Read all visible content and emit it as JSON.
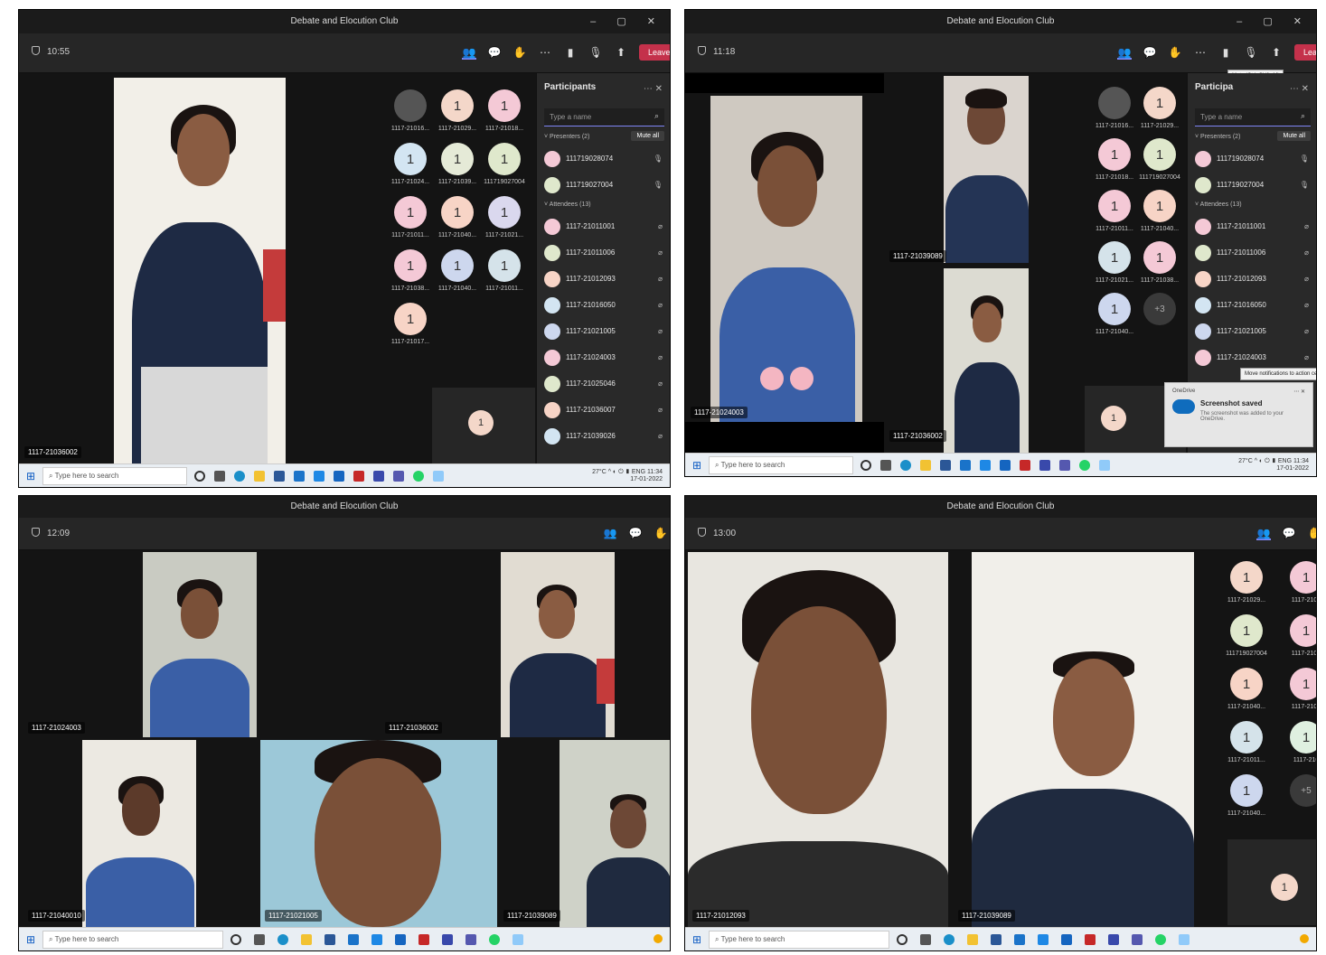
{
  "panels": {
    "p1": {
      "title": "Debate and Elocution Club",
      "time": "10:55",
      "leave_label": "Leave",
      "main_video_name": "1117-21036002",
      "self_view_avatar": "1",
      "avatars": [
        {
          "initial": "",
          "name": "1117-21016...",
          "color": "#555555"
        },
        {
          "initial": "1",
          "name": "1117-21029...",
          "color": "#f4d7c9"
        },
        {
          "initial": "1",
          "name": "1117-21018...",
          "color": "#f4c9d6"
        },
        {
          "initial": "1",
          "name": "1117-21024...",
          "color": "#d3e5f2"
        },
        {
          "initial": "1",
          "name": "1117-21039...",
          "color": "#e5ead7"
        },
        {
          "initial": "1",
          "name": "111719027004",
          "color": "#dfe8cc"
        },
        {
          "initial": "1",
          "name": "1117-21011...",
          "color": "#f4c9d6"
        },
        {
          "initial": "1",
          "name": "1117-21040...",
          "color": "#f7d4c6"
        },
        {
          "initial": "1",
          "name": "1117-21021...",
          "color": "#dad8ee"
        },
        {
          "initial": "1",
          "name": "1117-21038...",
          "color": "#f4c9d6"
        },
        {
          "initial": "1",
          "name": "1117-21040...",
          "color": "#cdd7ee"
        },
        {
          "initial": "1",
          "name": "1117-21011...",
          "color": "#d5e3ea"
        },
        {
          "initial": "1",
          "name": "1117-21017...",
          "color": "#f7d4c6"
        }
      ],
      "participants_title": "Participants",
      "search_placeholder": "Type a name",
      "presenters_label": "Presenters (2)",
      "mute_all_label": "Mute all",
      "attendees_label": "Attendees (13)",
      "presenters": [
        "111719028074",
        "111719027004"
      ],
      "attendees": [
        "1117-21011001",
        "1117-21011006",
        "1117-21012093",
        "1117-21016050",
        "1117-21021005",
        "1117-21024003",
        "1117-21025046",
        "1117-21036007",
        "1117-21039026"
      ]
    },
    "p2": {
      "title": "Debate and Elocution Club",
      "time": "11:18",
      "leave_label": "Leave",
      "mute_tooltip": "Mute (Ctrl+Shift+M)",
      "videos": [
        "1117-21024003",
        "1117-21039089",
        "1117-21036002"
      ],
      "avatars": [
        {
          "initial": "",
          "name": "1117-21016...",
          "color": "#555555"
        },
        {
          "initial": "1",
          "name": "1117-21029...",
          "color": "#f4d7c9"
        },
        {
          "initial": "1",
          "name": "1117-21018...",
          "color": "#f4c9d6"
        },
        {
          "initial": "1",
          "name": "111719027004",
          "color": "#dfe8cc"
        },
        {
          "initial": "1",
          "name": "1117-21011...",
          "color": "#f4c9d6"
        },
        {
          "initial": "1",
          "name": "1117-21040...",
          "color": "#f7d4c6"
        },
        {
          "initial": "1",
          "name": "1117-21021...",
          "color": "#d5e3ea"
        },
        {
          "initial": "1",
          "name": "1117-21038...",
          "color": "#f4c9d6"
        },
        {
          "initial": "1",
          "name": "1117-21040...",
          "color": "#cdd7ee"
        },
        {
          "initial": "+3",
          "name": "",
          "color": "#3a3a3a"
        }
      ],
      "self_view_avatar": "1",
      "participants_title": "Participa",
      "search_placeholder": "Type a name",
      "presenters_label": "Presenters (2)",
      "mute_all_label": "Mute all",
      "attendees_label": "Attendees (13)",
      "presenters": [
        "111719028074",
        "111719027004"
      ],
      "attendees": [
        "1117-21011001",
        "1117-21011006",
        "1117-21012093",
        "1117-21016050",
        "1117-21021005",
        "1117-21024003"
      ],
      "notification_tooltip": "Move notifications to action center",
      "toast": {
        "app": "OneDrive",
        "title": "Screenshot saved",
        "body": "The screenshot was added to your OneDrive."
      }
    },
    "p3": {
      "title": "Debate and Elocution Club",
      "time": "12:09",
      "videos": [
        "1117-21024003",
        "1117-21036002",
        "1117-21040010",
        "1117-21021005",
        "1117-21039089"
      ]
    },
    "p4": {
      "title": "Debate and Elocution Club",
      "time": "13:00",
      "videos": [
        "1117-21012093",
        "1117-21039089"
      ],
      "avatars": [
        {
          "initial": "1",
          "name": "1117-21029...",
          "color": "#f4d7c9"
        },
        {
          "initial": "1",
          "name": "1117-2104",
          "color": "#f4c9d6"
        },
        {
          "initial": "1",
          "name": "111719027004",
          "color": "#dfe8cc"
        },
        {
          "initial": "1",
          "name": "1117-2101",
          "color": "#f4c9d6"
        },
        {
          "initial": "1",
          "name": "1117-21040...",
          "color": "#f7d4c6"
        },
        {
          "initial": "1",
          "name": "1117-2103",
          "color": "#f4c9d6"
        },
        {
          "initial": "1",
          "name": "1117-21011...",
          "color": "#d5e3ea"
        },
        {
          "initial": "1",
          "name": "1117-210",
          "color": "#dff0e0"
        },
        {
          "initial": "1",
          "name": "1117-21040...",
          "color": "#cdd7ee"
        },
        {
          "initial": "+5",
          "name": "",
          "color": "#3a3a3a"
        }
      ],
      "self_view_avatar": "1"
    }
  },
  "taskbar": {
    "search_placeholder": "Type here to search",
    "weather": "27°C",
    "lang": "ENG",
    "time": "11:34",
    "date": "17-01-2022"
  }
}
